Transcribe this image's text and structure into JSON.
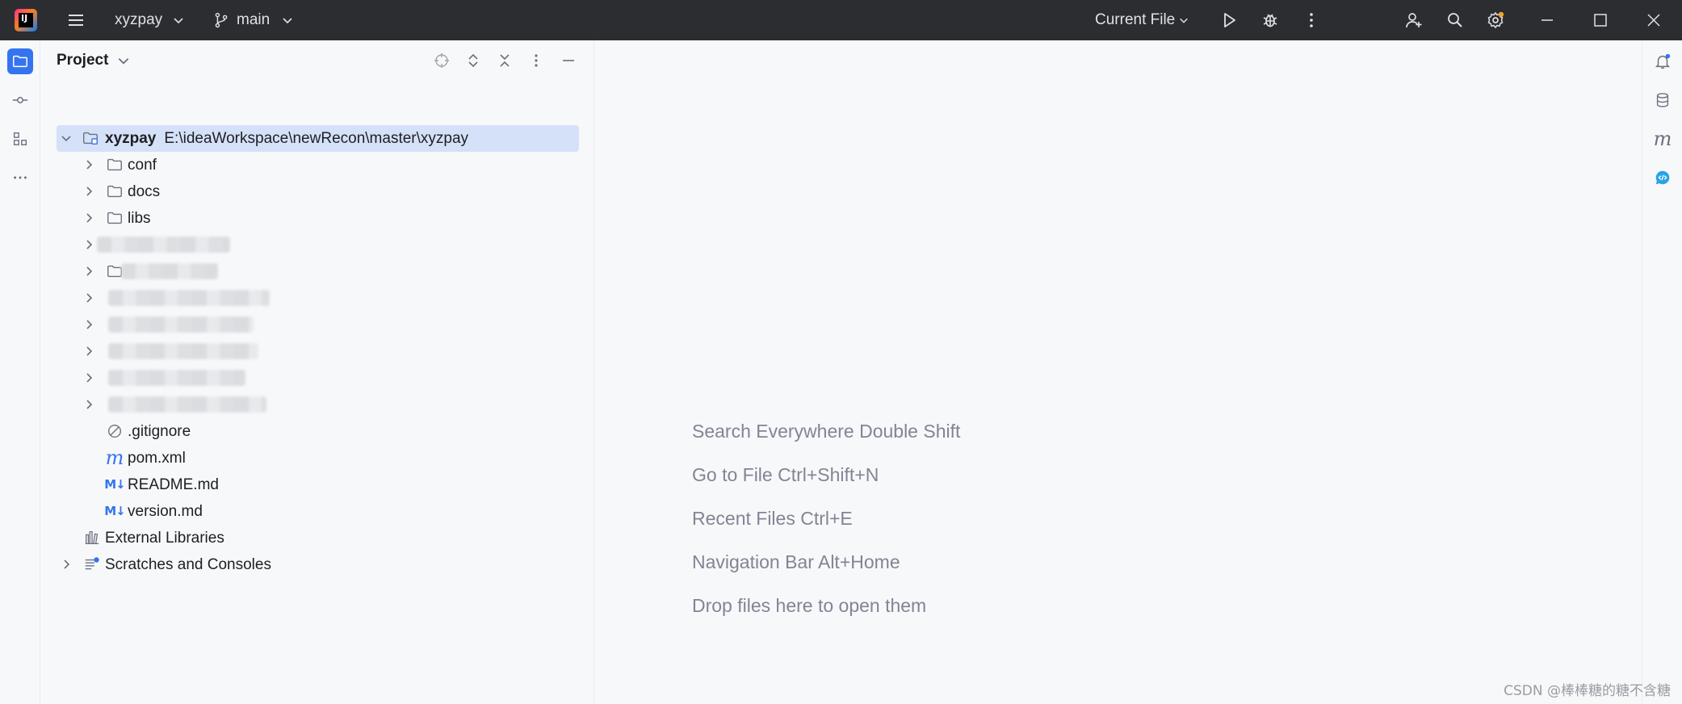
{
  "titlebar": {
    "project_name": "xyzpay",
    "branch": "main",
    "run_config": "Current File",
    "icons": [
      "main-menu-icon",
      "branch-icon",
      "run-icon",
      "debug-icon",
      "more-icon",
      "add-user-icon",
      "search-icon",
      "settings-icon",
      "minimize-icon",
      "maximize-icon",
      "close-icon"
    ],
    "colors": {
      "bg": "#2b2d30",
      "text": "#dfe1e5",
      "settings_badge": "#f2a72b"
    }
  },
  "left_strip": {
    "items": [
      "project-tool-icon",
      "commit-tool-icon",
      "structure-tool-icon",
      "more-tools-icon"
    ]
  },
  "right_strip": {
    "items": [
      "notifications-icon",
      "database-icon",
      "maven-icon",
      "ai-assistant-icon"
    ]
  },
  "project_panel": {
    "title": "Project",
    "root": {
      "name": "xyzpay",
      "path": "E:\\ideaWorkspace\\newRecon\\master\\xyzpay"
    },
    "folders": [
      "conf",
      "docs",
      "libs"
    ],
    "files": [
      {
        "name": ".gitignore",
        "icon": "ignore-file-icon"
      },
      {
        "name": "pom.xml",
        "icon": "maven-file-icon",
        "glyph": "m"
      },
      {
        "name": "README.md",
        "icon": "markdown-file-icon",
        "glyph": "M↓"
      },
      {
        "name": "version.md",
        "icon": "markdown-file-icon",
        "glyph": "M↓"
      }
    ],
    "external_libraries": "External Libraries",
    "scratches": "Scratches and Consoles",
    "colors": {
      "selection": "#d5e1f8",
      "accent": "#3574f0"
    }
  },
  "editor": {
    "hints": [
      "Search Everywhere Double Shift",
      "Go to File Ctrl+Shift+N",
      "Recent Files Ctrl+E",
      "Navigation Bar Alt+Home",
      "Drop files here to open them"
    ]
  },
  "watermark": "CSDN @棒棒糖的糖不含糖"
}
